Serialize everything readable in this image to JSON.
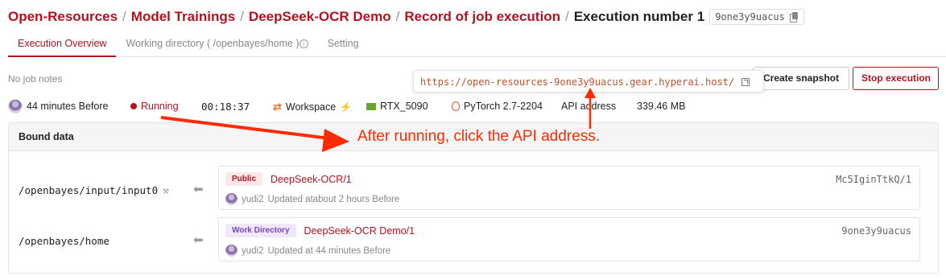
{
  "breadcrumb": {
    "items": [
      "Open-Resources",
      "Model Trainings",
      "DeepSeek-OCR Demo",
      "Record of job execution"
    ],
    "separator": "/",
    "current": "Execution number 1",
    "execution_id": "9one3y9uacus"
  },
  "tabs": [
    {
      "label": "Execution Overview",
      "active": true
    },
    {
      "label": "Working directory ( /openbayes/home )",
      "active": false
    },
    {
      "label": "Setting",
      "active": false
    }
  ],
  "job_notes": "No job notes",
  "api_url": "https://open-resources-9one3y9uacus.gear.hyperai.host/",
  "actions": {
    "snapshot": "Create snapshot",
    "stop": "Stop execution"
  },
  "status": {
    "started": "44 minutes Before",
    "state": "Running",
    "duration": "00:18:37",
    "mode": "Workspace",
    "gpu": "RTX_5090",
    "framework": "PyTorch 2.7-2204",
    "api_label": "API address",
    "size": "339.46 MB"
  },
  "bound_data": {
    "title": "Bound data",
    "rows": [
      {
        "path": "/openbayes/input/input0",
        "badge": "Public",
        "name": "DeepSeek-OCR/1",
        "id": "Mc5IginTtkQ/1",
        "user": "yudi2",
        "updated": "Updated atabout 2 hours Before"
      },
      {
        "path": "/openbayes/home",
        "badge": "Work Directory",
        "name": "DeepSeek-OCR Demo/1",
        "id": "9one3y9uacus",
        "user": "yudi2",
        "updated": "Updated at 44 minutes Before"
      }
    ]
  },
  "annotation": "After running, click the API address.",
  "colors": {
    "brand": "#b3121f",
    "annotation": "#ff2a00",
    "url": "#c0532a"
  }
}
